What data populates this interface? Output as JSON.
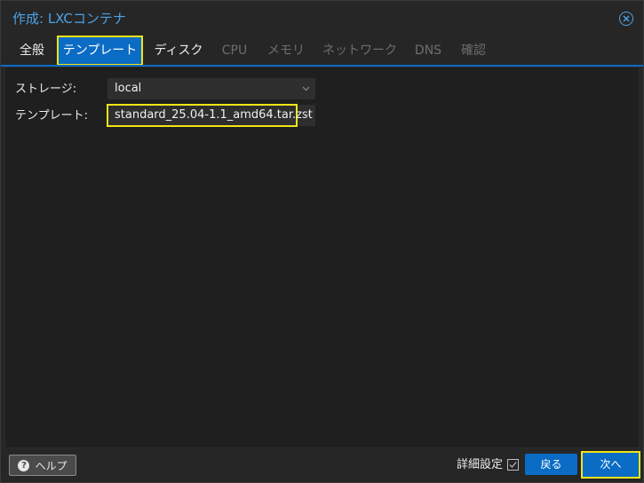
{
  "window": {
    "title": "作成: LXCコンテナ"
  },
  "tabs": [
    {
      "label": "全般",
      "state": "enabled"
    },
    {
      "label": "テンプレート",
      "state": "active"
    },
    {
      "label": "ディスク",
      "state": "enabled"
    },
    {
      "label": "CPU",
      "state": "disabled"
    },
    {
      "label": "メモリ",
      "state": "disabled"
    },
    {
      "label": "ネットワーク",
      "state": "disabled"
    },
    {
      "label": "DNS",
      "state": "disabled"
    },
    {
      "label": "確認",
      "state": "disabled"
    }
  ],
  "form": {
    "storage": {
      "label": "ストレージ:",
      "value": "local"
    },
    "template": {
      "label": "テンプレート:",
      "value": "standard_25.04-1.1_amd64.tar.zst"
    }
  },
  "footer": {
    "help_label": "ヘルプ",
    "advanced_label": "詳細設定",
    "advanced_checked": true,
    "back_label": "戻る",
    "next_label": "次へ"
  },
  "colors": {
    "accent": "#0a6cc4",
    "title": "#4aa3e8",
    "highlight": "#f2e416",
    "background": "#262626"
  }
}
